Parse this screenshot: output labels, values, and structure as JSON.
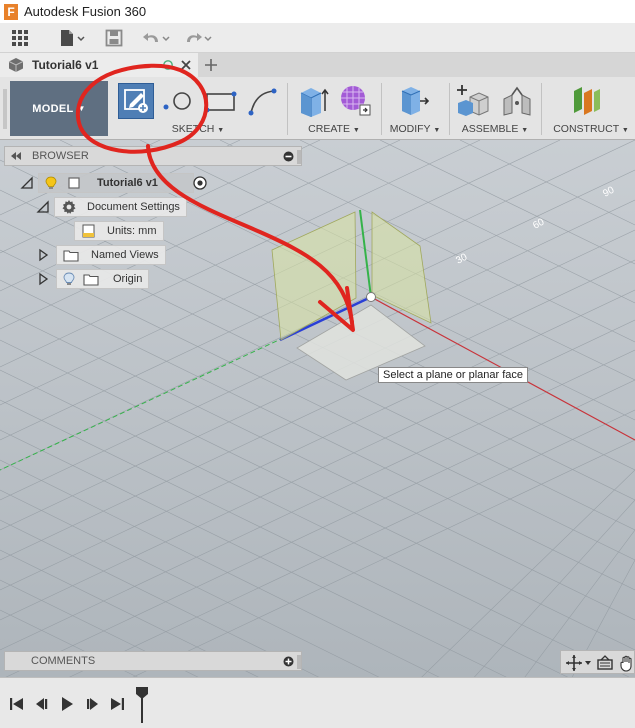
{
  "app": {
    "title": "Autodesk Fusion 360",
    "logo_letter": "F"
  },
  "document": {
    "tab_label": "Tutorial6 v1"
  },
  "toolbar": {
    "workspace_label": "MODEL",
    "groups": {
      "sketch": "SKETCH",
      "create": "CREATE",
      "modify": "MODIFY",
      "assemble": "ASSEMBLE",
      "construct": "CONSTRUCT"
    }
  },
  "browser": {
    "title": "BROWSER",
    "root": "Tutorial6 v1",
    "document_settings": "Document Settings",
    "units": "Units: mm",
    "named_views": "Named Views",
    "origin": "Origin"
  },
  "viewport": {
    "tooltip": "Select a plane or planar face",
    "grid_labels": [
      "30",
      "60",
      "90"
    ]
  },
  "comments": {
    "title": "COMMENTS"
  },
  "colors": {
    "annotation_red": "#e0251f",
    "workspace_button": "#5f6f81",
    "sketch_icon_bg": "#4f7eb5",
    "axis_x": "#c8333a",
    "axis_y": "#35b34a",
    "axis_z": "#2a3fd6"
  }
}
